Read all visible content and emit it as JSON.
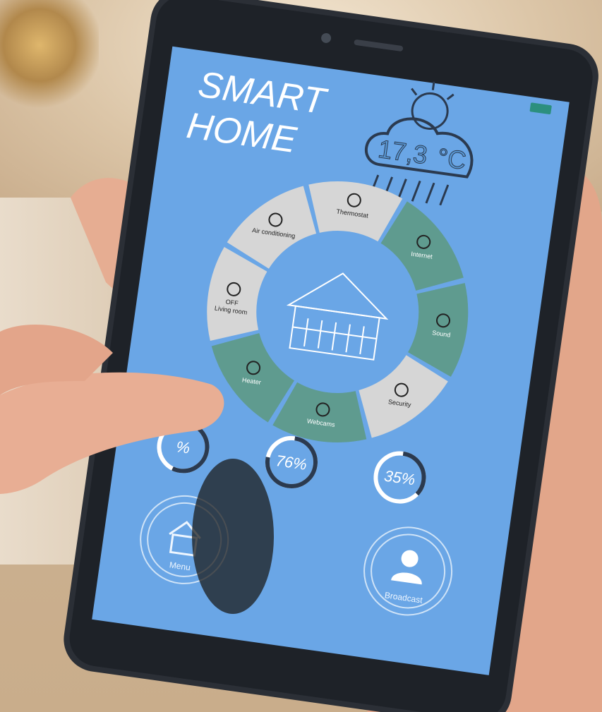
{
  "app": {
    "title_line1": "SMART",
    "title_line2": "HOME"
  },
  "weather": {
    "temperature": "17,3",
    "unit": "°C",
    "icon": "cloud-rain-sun-icon"
  },
  "wheel": {
    "segments": [
      {
        "label": "Thermostat",
        "icon": "thermometer-icon",
        "state": "gray"
      },
      {
        "label": "Internet",
        "icon": "wifi-icon",
        "state": "teal"
      },
      {
        "label": "Sound",
        "icon": "music-note-icon",
        "state": "teal"
      },
      {
        "label": "Security",
        "icon": "shield-icon",
        "state": "gray"
      },
      {
        "label": "Webcams",
        "icon": "eye-icon",
        "state": "teal"
      },
      {
        "label": "Heater",
        "icon": "heater-icon",
        "state": "teal"
      },
      {
        "label": "OFF",
        "sublabel": "Living room",
        "icon": "bulb-icon",
        "state": "gray"
      },
      {
        "label": "Air conditioning",
        "icon": "fan-icon",
        "state": "gray"
      }
    ]
  },
  "gauges": [
    {
      "label": "%",
      "value": 0.55
    },
    {
      "label": "76%",
      "value": 0.76
    },
    {
      "label": "35%",
      "value": 0.35
    }
  ],
  "bottom": {
    "menu_label": "Menu",
    "broadcast_label": "Broadcast"
  },
  "colors": {
    "screen": "#6aa6e6",
    "teal": "#5f9b8f",
    "gray": "#d6d6d6",
    "phone": "#2b2f36"
  }
}
